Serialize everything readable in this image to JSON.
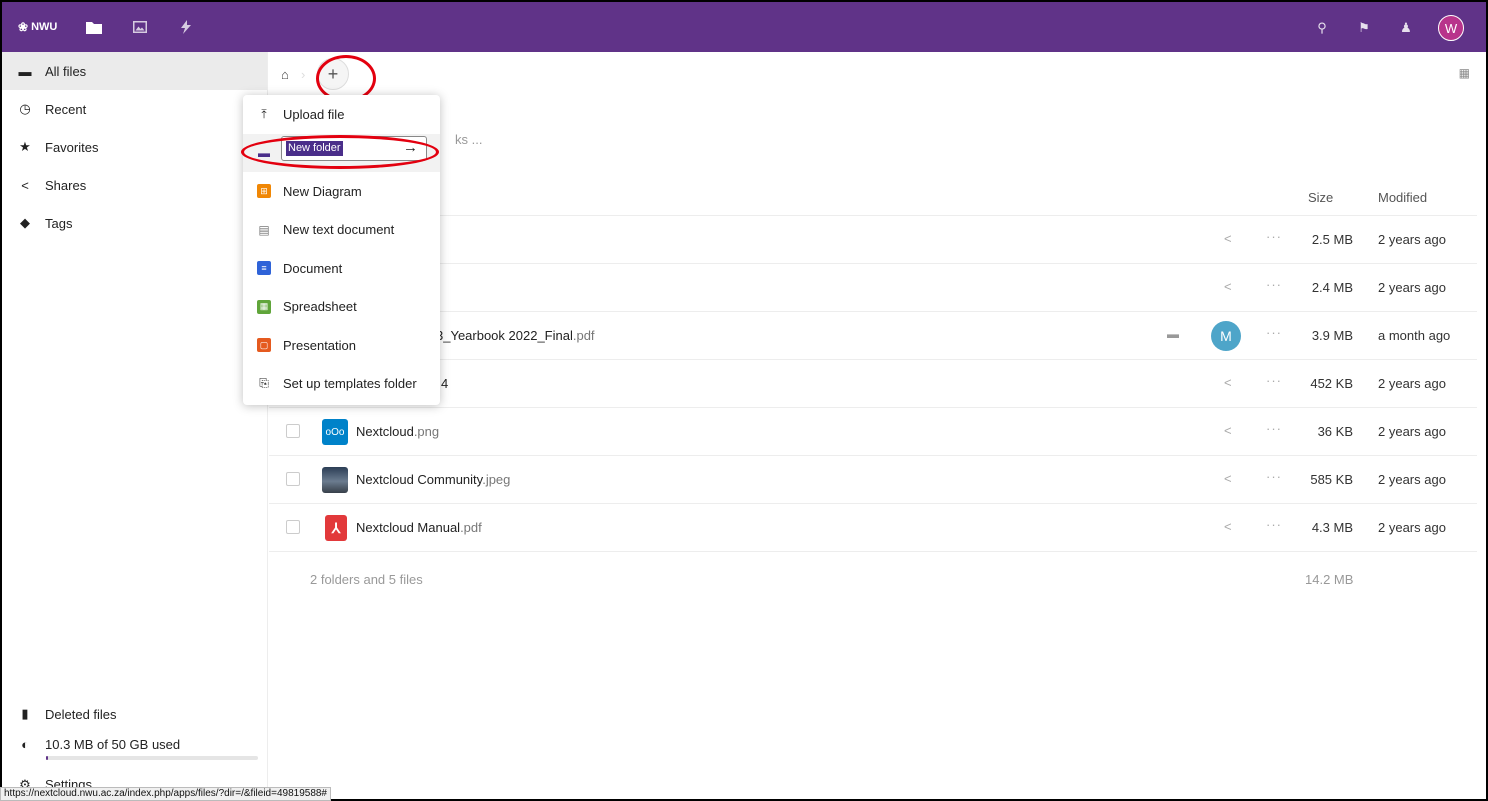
{
  "header": {
    "logo_text": "NWU",
    "avatar_letter": "W",
    "colors": {
      "brand": "#603388",
      "avatar": "#b8338b"
    }
  },
  "sidebar": {
    "items": [
      {
        "label": "All files",
        "icon": "folder-icon"
      },
      {
        "label": "Recent",
        "icon": "clock-icon"
      },
      {
        "label": "Favorites",
        "icon": "star-icon"
      },
      {
        "label": "Shares",
        "icon": "share-icon"
      },
      {
        "label": "Tags",
        "icon": "tag-icon"
      }
    ],
    "deleted_files": "Deleted files",
    "quota_text": "10.3 MB of 50 GB used",
    "quota_fraction": 0.0002,
    "settings": "Settings"
  },
  "main": {
    "search_hint": "ks ...",
    "columns": {
      "size": "Size",
      "modified": "Modified"
    },
    "files": [
      {
        "name": "",
        "ext": "",
        "size": "2.5 MB",
        "modified": "2 years ago"
      },
      {
        "name": "",
        "ext": "",
        "size": "2.4 MB",
        "modified": "2 years ago"
      },
      {
        "name": "3_Yearbook 2022_Final",
        "ext": ".pdf",
        "size": "3.9 MB",
        "modified": "a month ago",
        "shared_avatar": "M"
      },
      {
        "name": "4",
        "ext": "",
        "size": "452 KB",
        "modified": "2 years ago"
      },
      {
        "name": "Nextcloud",
        "ext": ".png",
        "size": "36 KB",
        "modified": "2 years ago"
      },
      {
        "name": "Nextcloud Community",
        "ext": ".jpeg",
        "size": "585 KB",
        "modified": "2 years ago"
      },
      {
        "name": "Nextcloud Manual",
        "ext": ".pdf",
        "size": "4.3 MB",
        "modified": "2 years ago"
      }
    ],
    "summary_text": "2 folders and 5 files",
    "summary_size": "14.2 MB"
  },
  "new_menu": {
    "items": [
      {
        "label": "Upload file",
        "icon": "upload-icon"
      },
      {
        "label": "New folder",
        "icon": "folder-icon"
      },
      {
        "label": "New Diagram",
        "icon": "diagram-icon"
      },
      {
        "label": "New text document",
        "icon": "text-document-icon"
      },
      {
        "label": "Document",
        "icon": "document-icon"
      },
      {
        "label": "Spreadsheet",
        "icon": "spreadsheet-icon"
      },
      {
        "label": "Presentation",
        "icon": "presentation-icon"
      },
      {
        "label": "Set up templates folder",
        "icon": "templates-icon"
      }
    ],
    "new_folder_value": "New folder"
  },
  "status_bar": {
    "url": "https://nextcloud.nwu.ac.za/index.php/apps/files/?dir=/&fileid=49819588#"
  }
}
